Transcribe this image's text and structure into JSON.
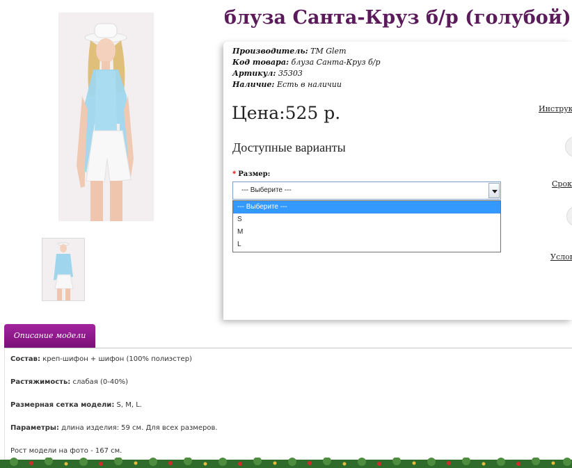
{
  "product": {
    "title": "блуза Санта-Круз б/р (голубой)",
    "manufacturer_label": "Производитель:",
    "manufacturer": "TM Glem",
    "code_label": "Код товара:",
    "code": "блуза Санта-Круз б/р",
    "sku_label": "Артикул:",
    "sku": "35303",
    "availability_label": "Наличие:",
    "availability": "Есть в наличии",
    "price": "Цена:525 р."
  },
  "options": {
    "heading": "Доступные варианты",
    "size_label": "Размер:",
    "size_selected": "--- Выберите ---",
    "size_options": [
      "--- Выберите ---",
      "S",
      "M",
      "L"
    ]
  },
  "sidebar": {
    "link1": "Инструкц",
    "link2": "Сроки",
    "link3": "Услов"
  },
  "tabs": {
    "description": "Описание модели"
  },
  "description": {
    "composition_label": "Состав:",
    "composition": "креп-шифон + шифон (100% полиэстер)",
    "stretch_label": "Растяжимость:",
    "stretch": "слабая (0-40%)",
    "sizes_label": "Размерная сетка модели:",
    "sizes": "S, M, L.",
    "params_label": "Параметры:",
    "params": "длина изделия: 59 см. Для всех размеров.",
    "height": "Рост модели на фото - 167 см."
  },
  "colors": {
    "title": "#5b1a5a",
    "tab": "#8e1a8a",
    "selected_option": "#3399ff",
    "blouse": "#9fd6ee"
  }
}
